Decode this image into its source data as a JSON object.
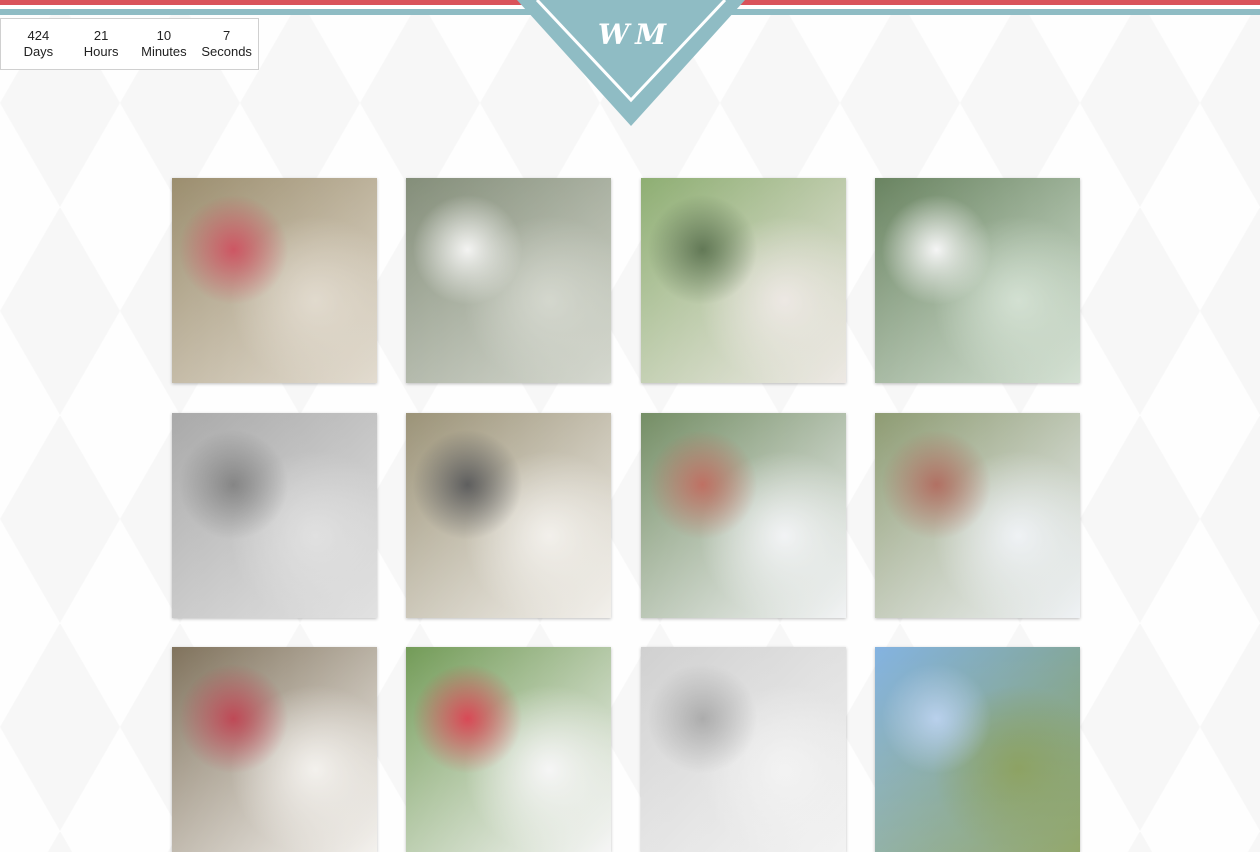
{
  "countdown": {
    "days": {
      "value": "424",
      "label": "Days"
    },
    "hours": {
      "value": "21",
      "label": "Hours"
    },
    "minutes": {
      "value": "10",
      "label": "Minutes"
    },
    "seconds": {
      "value": "7",
      "label": "Seconds"
    }
  },
  "logo": {
    "text": "W M"
  },
  "colors": {
    "accent_red": "#d9535b",
    "accent_teal": "#8fbcc4"
  },
  "gallery": {
    "photos": [
      {
        "name": "photo-bouquet-roses",
        "colors": [
          "#8a7a55",
          "#d9d0c0",
          "#c23040"
        ]
      },
      {
        "name": "photo-groom-forest",
        "colors": [
          "#6e7a62",
          "#c8ccc0",
          "#f1f1ef"
        ]
      },
      {
        "name": "photo-bride-tiara",
        "colors": [
          "#7aa05a",
          "#e8e2dc",
          "#3f5a30"
        ]
      },
      {
        "name": "photo-bride-woods",
        "colors": [
          "#4f6e45",
          "#c7d8c6",
          "#f3f3f3"
        ]
      },
      {
        "name": "photo-forest-gray",
        "colors": [
          "#9a9a9a",
          "#d8d8d8",
          "#6a6a6a"
        ]
      },
      {
        "name": "photo-couple-closeup",
        "colors": [
          "#8a8060",
          "#efece6",
          "#3a3a3a"
        ]
      },
      {
        "name": "photo-couple-manor",
        "colors": [
          "#5c7a4a",
          "#eef0f2",
          "#b05040"
        ]
      },
      {
        "name": "photo-veil-tree",
        "colors": [
          "#7a8a5a",
          "#eaeef2",
          "#a05040"
        ]
      },
      {
        "name": "photo-roses-hands",
        "colors": [
          "#6a5a40",
          "#f0ede8",
          "#b02030"
        ]
      },
      {
        "name": "photo-roses-bright",
        "colors": [
          "#5a8a3a",
          "#f3f3f3",
          "#d02030"
        ]
      },
      {
        "name": "photo-white-gazebo",
        "colors": [
          "#c8c8c8",
          "#efefef",
          "#9a9a9a"
        ]
      },
      {
        "name": "photo-ivy-building",
        "colors": [
          "#6ea6dc",
          "#6f8a3a",
          "#a9c6e8"
        ]
      }
    ]
  }
}
